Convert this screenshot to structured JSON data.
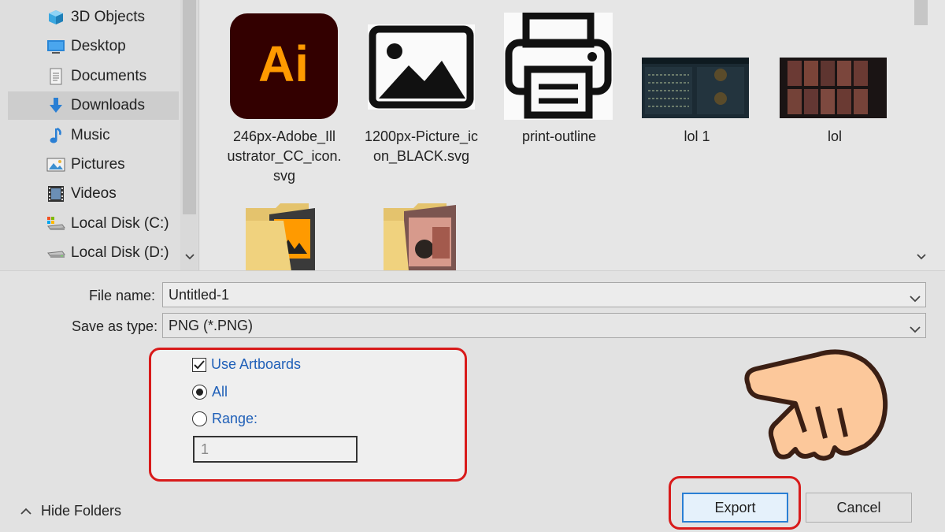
{
  "navigation": {
    "items": [
      {
        "label": "3D Objects",
        "icon": "3d-objects-icon"
      },
      {
        "label": "Desktop",
        "icon": "desktop-icon"
      },
      {
        "label": "Documents",
        "icon": "documents-icon"
      },
      {
        "label": "Downloads",
        "icon": "downloads-icon",
        "selected": true
      },
      {
        "label": "Music",
        "icon": "music-icon"
      },
      {
        "label": "Pictures",
        "icon": "pictures-icon"
      },
      {
        "label": "Videos",
        "icon": "videos-icon"
      },
      {
        "label": "Local Disk (C:)",
        "icon": "local-disk-c-icon"
      },
      {
        "label": "Local Disk (D:)",
        "icon": "local-disk-d-icon"
      }
    ]
  },
  "files": [
    {
      "name": "246px-Adobe_Illustrator_CC_icon.svg",
      "lines": [
        "246px-Adobe_Ill",
        "ustrator_CC_icon.",
        "svg"
      ],
      "icon": "illustrator-icon",
      "icon_text": "Ai"
    },
    {
      "name": "1200px-Picture_icon_BLACK.svg",
      "lines": [
        "1200px-Picture_ic",
        "on_BLACK.svg"
      ],
      "icon": "picture-icon"
    },
    {
      "name": "print-outline",
      "lines": [
        "print-outline"
      ],
      "icon": "printer-icon"
    },
    {
      "name": "lol 1",
      "lines": [
        "lol 1"
      ],
      "icon": "game-screenshot-thumbnail"
    },
    {
      "name": "lol",
      "lines": [
        "lol"
      ],
      "icon": "game-screenshot-thumbnail"
    },
    {
      "name": "",
      "lines": [],
      "icon": "folder-icon"
    },
    {
      "name": "",
      "lines": [],
      "icon": "folder-icon"
    }
  ],
  "form": {
    "file_name_label": "File name:",
    "file_name_value": "Untitled-1",
    "save_type_label": "Save as type:",
    "save_type_value": "PNG (*.PNG)"
  },
  "artboards": {
    "use_artboards_label": "Use Artboards",
    "use_artboards_checked": true,
    "all_label": "All",
    "range_label": "Range:",
    "selected": "all",
    "range_value": "1"
  },
  "footer": {
    "hide_folders_label": "Hide Folders",
    "export_label": "Export",
    "cancel_label": "Cancel"
  },
  "colors": {
    "highlight_red": "#d81a1a",
    "link_blue": "#2060b8",
    "primary_border": "#2a7fd4",
    "illustrator_bg": "#330000",
    "illustrator_fg": "#ff9a00",
    "hand_fill": "#fcc89b"
  }
}
